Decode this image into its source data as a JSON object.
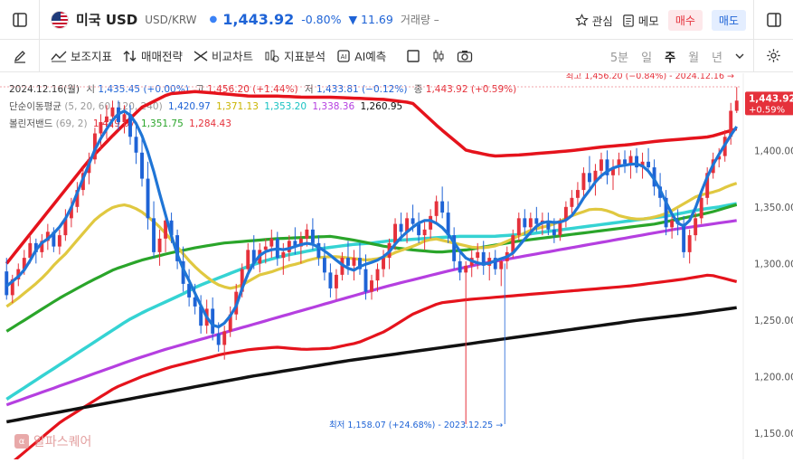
{
  "header": {
    "title": "미국 USD",
    "pair": "USD/KRW",
    "price": "1,443.92",
    "change_pct": "-0.80%",
    "change_val": "▼ 11.69",
    "volume": "거래량 –",
    "watch_label": "관심",
    "memo_label": "메모",
    "buy_label": "매수",
    "sell_label": "매도"
  },
  "toolbar": {
    "tools": [
      "보조지표",
      "매매전략",
      "비교차트",
      "지표분석",
      "AI예측"
    ],
    "periods": [
      "5분",
      "일",
      "주",
      "월",
      "년"
    ],
    "active_period": "주"
  },
  "legend": {
    "ohlc": {
      "date": "2024.12.16(월)",
      "open_label": "시",
      "open": "1,435.45 (+0.00%)",
      "high_label": "고",
      "high": "1,456.20 (+1.44%)",
      "low_label": "저",
      "low": "1,433.81 (−0.12%)",
      "close_label": "종",
      "close": "1,443.92 (+0.59%)"
    },
    "sma": {
      "label": "단순이동평균",
      "params": "(5, 20, 60, 120, 240)",
      "values": [
        "1,420.97",
        "1,371.13",
        "1,353.20",
        "1,338.36",
        "1,260.95"
      ],
      "colors": [
        "#1e63d6",
        "#c9b400",
        "#18c2c2",
        "#b53fe0",
        "#111111"
      ]
    },
    "bb": {
      "label": "볼린저밴드",
      "params": "(69, 2)",
      "values": [
        "1,419.07",
        "1,351.75",
        "1,284.43"
      ],
      "colors": [
        "#e5313b",
        "#2aa52a",
        "#e5313b"
      ]
    }
  },
  "chart_data": {
    "type": "candlestick",
    "symbol": "USD/KRW",
    "interval": "weekly",
    "ylim": [
      1130,
      1465
    ],
    "yticks": [
      1150,
      1200,
      1250,
      1300,
      1350,
      1400
    ],
    "ytick_labels": [
      "1,150.00",
      "1,200.00",
      "1,250.00",
      "1,300.00",
      "1,350.00",
      "1,400.00"
    ],
    "last_price_label": "1,443.92",
    "last_change_label": "+0.59%",
    "high_annotation": "최고 1,456.20 (−0.84%) - 2024.12.16",
    "low_annotation": "최저 1,158.07 (+24.68%) - 2023.12.25",
    "candles": [
      [
        1293,
        1305,
        1268,
        1272
      ],
      [
        1272,
        1290,
        1265,
        1286
      ],
      [
        1286,
        1300,
        1280,
        1295
      ],
      [
        1295,
        1312,
        1290,
        1305
      ],
      [
        1305,
        1325,
        1300,
        1318
      ],
      [
        1318,
        1322,
        1300,
        1310
      ],
      [
        1310,
        1326,
        1305,
        1320
      ],
      [
        1320,
        1335,
        1312,
        1328
      ],
      [
        1328,
        1332,
        1310,
        1315
      ],
      [
        1315,
        1330,
        1308,
        1325
      ],
      [
        1325,
        1348,
        1320,
        1340
      ],
      [
        1340,
        1358,
        1332,
        1350
      ],
      [
        1350,
        1372,
        1345,
        1365
      ],
      [
        1365,
        1385,
        1360,
        1380
      ],
      [
        1380,
        1398,
        1370,
        1392
      ],
      [
        1392,
        1420,
        1388,
        1415
      ],
      [
        1415,
        1432,
        1400,
        1425
      ],
      [
        1425,
        1440,
        1410,
        1430
      ],
      [
        1430,
        1444,
        1420,
        1438
      ],
      [
        1438,
        1444,
        1418,
        1425
      ],
      [
        1425,
        1440,
        1415,
        1432
      ],
      [
        1432,
        1440,
        1405,
        1412
      ],
      [
        1412,
        1425,
        1388,
        1398
      ],
      [
        1398,
        1410,
        1368,
        1375
      ],
      [
        1375,
        1390,
        1330,
        1340
      ],
      [
        1340,
        1355,
        1305,
        1310
      ],
      [
        1310,
        1330,
        1298,
        1322
      ],
      [
        1322,
        1345,
        1310,
        1338
      ],
      [
        1338,
        1345,
        1318,
        1325
      ],
      [
        1325,
        1330,
        1295,
        1302
      ],
      [
        1302,
        1315,
        1275,
        1282
      ],
      [
        1282,
        1295,
        1262,
        1270
      ],
      [
        1270,
        1282,
        1255,
        1262
      ],
      [
        1262,
        1272,
        1238,
        1245
      ],
      [
        1245,
        1268,
        1238,
        1260
      ],
      [
        1260,
        1270,
        1232,
        1238
      ],
      [
        1238,
        1248,
        1222,
        1228
      ],
      [
        1228,
        1245,
        1215,
        1240
      ],
      [
        1240,
        1262,
        1235,
        1255
      ],
      [
        1255,
        1282,
        1250,
        1275
      ],
      [
        1275,
        1300,
        1270,
        1295
      ],
      [
        1295,
        1318,
        1288,
        1312
      ],
      [
        1312,
        1325,
        1295,
        1300
      ],
      [
        1300,
        1318,
        1292,
        1312
      ],
      [
        1312,
        1322,
        1300,
        1315
      ],
      [
        1315,
        1330,
        1305,
        1322
      ],
      [
        1322,
        1328,
        1298,
        1305
      ],
      [
        1305,
        1318,
        1290,
        1310
      ],
      [
        1310,
        1325,
        1302,
        1320
      ],
      [
        1320,
        1332,
        1308,
        1315
      ],
      [
        1315,
        1328,
        1300,
        1322
      ],
      [
        1322,
        1335,
        1315,
        1330
      ],
      [
        1330,
        1340,
        1312,
        1318
      ],
      [
        1318,
        1325,
        1298,
        1305
      ],
      [
        1305,
        1318,
        1285,
        1292
      ],
      [
        1292,
        1300,
        1270,
        1278
      ],
      [
        1278,
        1295,
        1268,
        1290
      ],
      [
        1290,
        1310,
        1285,
        1305
      ],
      [
        1305,
        1320,
        1290,
        1298
      ],
      [
        1298,
        1312,
        1285,
        1305
      ],
      [
        1305,
        1318,
        1290,
        1295
      ],
      [
        1295,
        1308,
        1268,
        1275
      ],
      [
        1275,
        1290,
        1268,
        1285
      ],
      [
        1285,
        1300,
        1275,
        1295
      ],
      [
        1295,
        1312,
        1288,
        1305
      ],
      [
        1305,
        1322,
        1295,
        1318
      ],
      [
        1318,
        1340,
        1312,
        1335
      ],
      [
        1335,
        1345,
        1320,
        1328
      ],
      [
        1328,
        1345,
        1318,
        1340
      ],
      [
        1340,
        1352,
        1328,
        1335
      ],
      [
        1335,
        1345,
        1318,
        1325
      ],
      [
        1325,
        1338,
        1312,
        1330
      ],
      [
        1330,
        1348,
        1322,
        1342
      ],
      [
        1342,
        1360,
        1335,
        1355
      ],
      [
        1355,
        1368,
        1340,
        1345
      ],
      [
        1345,
        1355,
        1318,
        1325
      ],
      [
        1325,
        1332,
        1295,
        1302
      ],
      [
        1302,
        1310,
        1285,
        1292
      ],
      [
        1292,
        1302,
        1158,
        1298
      ],
      [
        1298,
        1312,
        1288,
        1305
      ],
      [
        1305,
        1318,
        1295,
        1310
      ],
      [
        1310,
        1320,
        1290,
        1298
      ],
      [
        1298,
        1310,
        1285,
        1305
      ],
      [
        1305,
        1312,
        1290,
        1295
      ],
      [
        1295,
        1305,
        1280,
        1302
      ],
      [
        1302,
        1315,
        1295,
        1310
      ],
      [
        1310,
        1330,
        1305,
        1325
      ],
      [
        1325,
        1345,
        1320,
        1340
      ],
      [
        1340,
        1348,
        1325,
        1332
      ],
      [
        1332,
        1345,
        1325,
        1340
      ],
      [
        1340,
        1350,
        1328,
        1335
      ],
      [
        1335,
        1345,
        1325,
        1338
      ],
      [
        1338,
        1345,
        1325,
        1330
      ],
      [
        1330,
        1340,
        1318,
        1325
      ],
      [
        1325,
        1340,
        1320,
        1338
      ],
      [
        1338,
        1355,
        1332,
        1350
      ],
      [
        1350,
        1365,
        1342,
        1358
      ],
      [
        1358,
        1372,
        1350,
        1365
      ],
      [
        1365,
        1385,
        1358,
        1380
      ],
      [
        1380,
        1395,
        1365,
        1372
      ],
      [
        1372,
        1388,
        1360,
        1382
      ],
      [
        1382,
        1398,
        1375,
        1392
      ],
      [
        1392,
        1400,
        1370,
        1378
      ],
      [
        1378,
        1392,
        1365,
        1385
      ],
      [
        1385,
        1398,
        1378,
        1392
      ],
      [
        1392,
        1400,
        1380,
        1388
      ],
      [
        1388,
        1400,
        1375,
        1395
      ],
      [
        1395,
        1402,
        1380,
        1385
      ],
      [
        1385,
        1398,
        1375,
        1390
      ],
      [
        1390,
        1402,
        1380,
        1385
      ],
      [
        1385,
        1392,
        1360,
        1368
      ],
      [
        1368,
        1380,
        1350,
        1358
      ],
      [
        1358,
        1365,
        1325,
        1332
      ],
      [
        1332,
        1345,
        1322,
        1338
      ],
      [
        1338,
        1348,
        1325,
        1335
      ],
      [
        1335,
        1342,
        1305,
        1310
      ],
      [
        1310,
        1330,
        1300,
        1325
      ],
      [
        1325,
        1345,
        1320,
        1340
      ],
      [
        1340,
        1362,
        1335,
        1358
      ],
      [
        1358,
        1385,
        1352,
        1380
      ],
      [
        1380,
        1398,
        1375,
        1392
      ],
      [
        1392,
        1402,
        1385,
        1395
      ],
      [
        1395,
        1418,
        1390,
        1412
      ],
      [
        1412,
        1442,
        1405,
        1435
      ],
      [
        1435,
        1456,
        1433,
        1444
      ]
    ],
    "sma5": [
      1280,
      1285,
      1290,
      1298,
      1310,
      1318,
      1322,
      1328,
      1335,
      1345,
      1360,
      1375,
      1390,
      1405,
      1415,
      1425,
      1432,
      1435,
      1430,
      1420,
      1405,
      1385,
      1362,
      1340,
      1318,
      1300,
      1288,
      1275,
      1262,
      1250,
      1243,
      1245,
      1252,
      1262,
      1280,
      1295,
      1305,
      1310,
      1312,
      1313,
      1312,
      1314,
      1316,
      1318,
      1317,
      1314,
      1310,
      1305,
      1300,
      1296,
      1294,
      1298,
      1300,
      1302,
      1305,
      1310,
      1318,
      1325,
      1330,
      1335,
      1338,
      1338,
      1335,
      1330,
      1322,
      1312,
      1305,
      1302,
      1300,
      1299,
      1302,
      1304,
      1306,
      1310,
      1318,
      1325,
      1332,
      1336,
      1337,
      1336,
      1337,
      1340,
      1348,
      1358,
      1366,
      1375,
      1380,
      1384,
      1386,
      1387,
      1388,
      1388,
      1384,
      1376,
      1365,
      1352,
      1340,
      1332,
      1335,
      1348,
      1365,
      1380,
      1392,
      1402,
      1412,
      1421
    ],
    "sma20": [
      1262,
      1268,
      1275,
      1282,
      1290,
      1300,
      1308,
      1318,
      1328,
      1338,
      1345,
      1350,
      1352,
      1350,
      1345,
      1338,
      1330,
      1320,
      1310,
      1300,
      1292,
      1285,
      1280,
      1278,
      1280,
      1285,
      1290,
      1292,
      1295,
      1298,
      1300,
      1303,
      1305,
      1306,
      1306,
      1305,
      1304,
      1303,
      1304,
      1306,
      1310,
      1313,
      1316,
      1320,
      1322,
      1320,
      1318,
      1316,
      1314,
      1314,
      1315,
      1318,
      1322,
      1326,
      1330,
      1332,
      1334,
      1338,
      1342,
      1345,
      1348,
      1348,
      1346,
      1342,
      1340,
      1339,
      1340,
      1342,
      1345,
      1350,
      1355,
      1360,
      1362,
      1364,
      1368,
      1371
    ],
    "sma60": [
      1180,
      1190,
      1200,
      1210,
      1220,
      1230,
      1240,
      1250,
      1258,
      1265,
      1272,
      1280,
      1286,
      1292,
      1298,
      1303,
      1307,
      1310,
      1313,
      1315,
      1317,
      1318,
      1320,
      1321,
      1322,
      1323,
      1324,
      1324,
      1324,
      1325,
      1326,
      1328,
      1330,
      1332,
      1334,
      1336,
      1338,
      1340,
      1342,
      1345,
      1348,
      1350,
      1353
    ],
    "sma120": [
      1175,
      1185,
      1195,
      1205,
      1215,
      1224,
      1232,
      1240,
      1248,
      1256,
      1264,
      1272,
      1280,
      1287,
      1294,
      1300,
      1305,
      1310,
      1315,
      1320,
      1325,
      1330,
      1334,
      1338
    ],
    "sma240": [
      1160,
      1168,
      1176,
      1184,
      1192,
      1200,
      1207,
      1214,
      1220,
      1226,
      1232,
      1238,
      1244,
      1250,
      1255,
      1261
    ],
    "bb_upper": [
      1300,
      1330,
      1360,
      1390,
      1415,
      1438,
      1450,
      1452,
      1450,
      1448,
      1448,
      1447,
      1447,
      1446,
      1445,
      1442,
      1420,
      1400,
      1395,
      1396,
      1398,
      1400,
      1403,
      1405,
      1408,
      1410,
      1412,
      1419
    ],
    "bb_mid": [
      1240,
      1255,
      1270,
      1283,
      1295,
      1303,
      1309,
      1314,
      1318,
      1320,
      1322,
      1323,
      1324,
      1320,
      1315,
      1312,
      1310,
      1312,
      1316,
      1320,
      1323,
      1326,
      1329,
      1332,
      1335,
      1340,
      1345,
      1352
    ],
    "bb_lower": [
      1120,
      1140,
      1160,
      1175,
      1190,
      1200,
      1208,
      1214,
      1220,
      1224,
      1226,
      1224,
      1225,
      1230,
      1240,
      1255,
      1265,
      1268,
      1270,
      1272,
      1274,
      1276,
      1278,
      1280,
      1283,
      1286,
      1290,
      1284
    ]
  },
  "watermark": "알파스퀘어"
}
